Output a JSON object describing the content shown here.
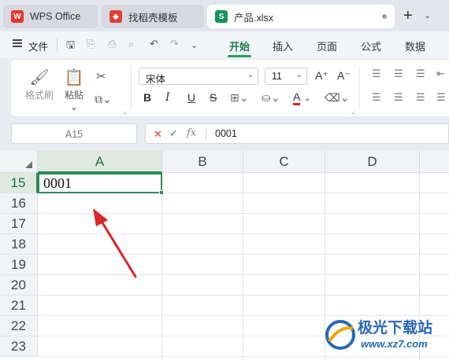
{
  "tabs": [
    {
      "label": "WPS Office",
      "icon": "wps-logo-icon"
    },
    {
      "label": "找稻壳模板",
      "icon": "docer-logo-icon"
    },
    {
      "label": "产品.xlsx",
      "icon": "spreadsheet-file-icon",
      "icon_letter": "S"
    }
  ],
  "menu": {
    "file_label": "文件",
    "ribbon_tabs": [
      "开始",
      "插入",
      "页面",
      "公式",
      "数据"
    ],
    "active_tab": "开始"
  },
  "ribbon": {
    "format_painter": "格式刷",
    "paste": "粘贴",
    "font_name": "宋体",
    "font_size": "11",
    "bold": "B",
    "italic": "I",
    "underline": "U",
    "strikethrough": "S",
    "font_color_letter": "A",
    "grow_font": "A⁺",
    "shrink_font": "A⁻",
    "font_color_hex": "#e02020"
  },
  "formula_bar": {
    "name_box": "A15",
    "cancel": "✕",
    "confirm": "✓",
    "fx": "fx",
    "value": "0001"
  },
  "sheet": {
    "columns": [
      "A",
      "B",
      "C",
      "D"
    ],
    "rows": [
      "15",
      "16",
      "17",
      "18",
      "19",
      "20",
      "21",
      "22",
      "23"
    ],
    "active_cell_value": "0001",
    "selected_column": "A",
    "selected_row": "15",
    "accent": "#2e8b57"
  },
  "watermark": {
    "brand": "极光下载站",
    "url": "www.xz7.com"
  }
}
